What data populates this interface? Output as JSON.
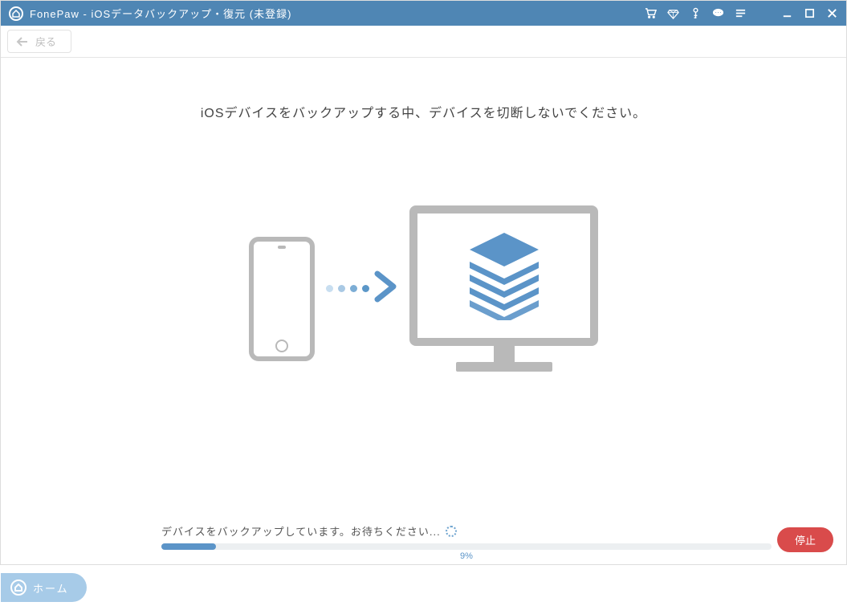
{
  "titlebar": {
    "title": "FonePaw - iOSデータバックアップ・復元 (未登録)"
  },
  "toolbar": {
    "back_label": "戻る"
  },
  "main": {
    "instruction": "iOSデバイスをバックアップする中、デバイスを切断しないでください。",
    "status_text": "デバイスをバックアップしています。お待ちください...",
    "progress_percent_label": "9%",
    "progress_percent_value": 9,
    "stop_label": "停止"
  },
  "footer": {
    "home_label": "ホーム"
  }
}
